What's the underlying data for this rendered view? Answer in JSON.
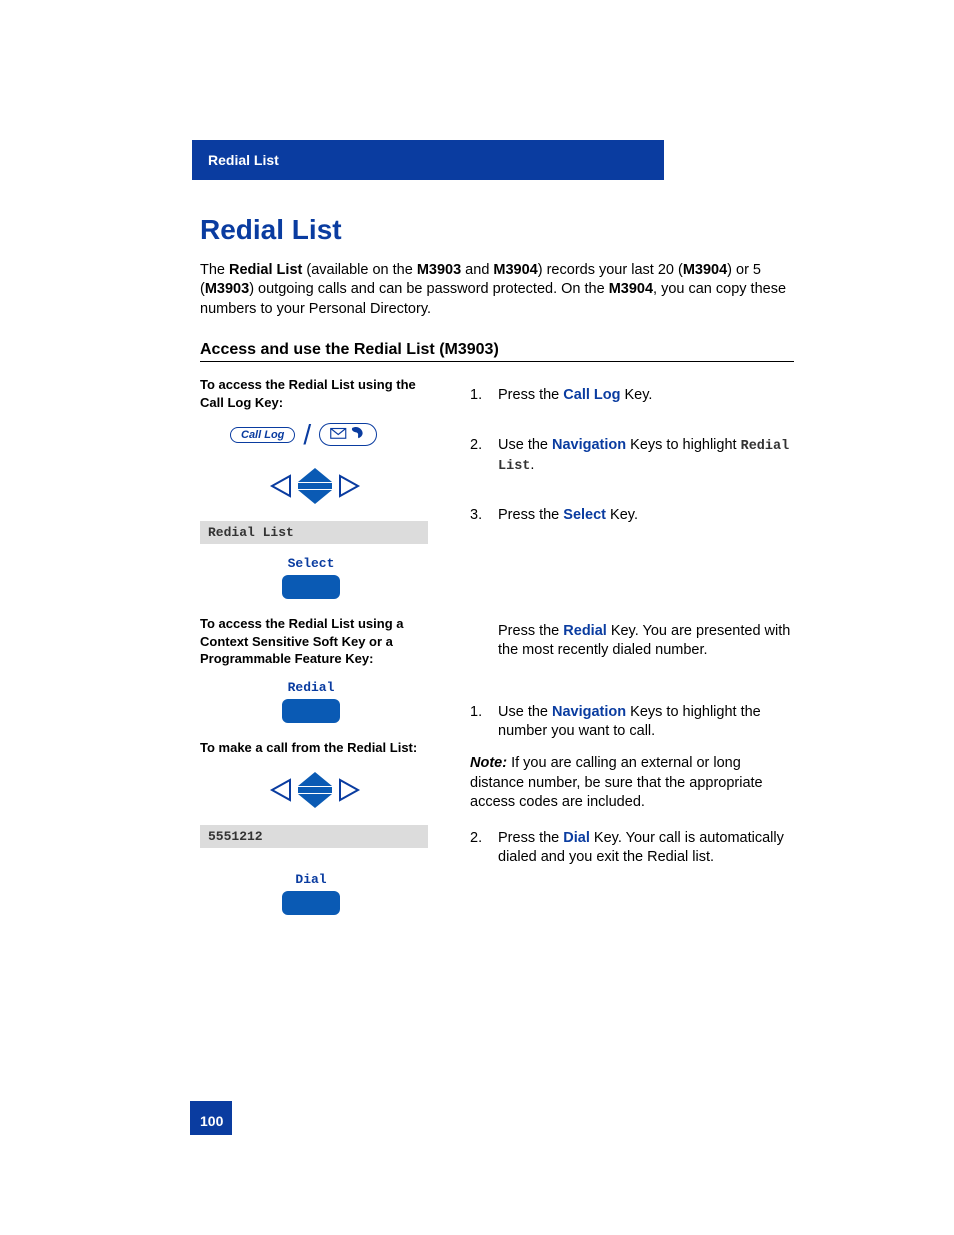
{
  "header": {
    "section": "Redial List"
  },
  "title": "Redial List",
  "intro": {
    "t1": "The ",
    "b1": "Redial List",
    "t2": " (available on the ",
    "b2": "M3903",
    "t3": " and ",
    "b3": "M3904",
    "t4": ") records your last 20 (",
    "b4": "M3904",
    "t5": ") or 5 (",
    "b5": "M3903",
    "t6": ") outgoing calls and can be password protected. On the ",
    "b6": "M3904",
    "t7": ", you can copy these numbers to your Personal Directory."
  },
  "subhead": "Access and use the Redial List (M3903)",
  "left": {
    "h1": "To access the Redial List using the Call Log Key:",
    "call_log_label": "Call Log",
    "lcd1": "Redial List",
    "sk_select": "Select",
    "h2": "To access the Redial List using a Context Sensitive Soft Key or a Programmable Feature Key:",
    "sk_redial": "Redial",
    "h3": "To make a call from the Redial List:",
    "lcd2": "5551212",
    "sk_dial": "Dial"
  },
  "steps": {
    "s1": {
      "num": "1.",
      "pre": "Press the ",
      "key": "Call Log",
      "post": " Key."
    },
    "s2": {
      "num": "2.",
      "pre": "Use the ",
      "key": "Navigation",
      "mid": " Keys to highlight ",
      "mono": "Redial List",
      "end": "."
    },
    "s3": {
      "num": "3.",
      "pre": "Press the ",
      "key": "Select",
      "post": " Key."
    },
    "redial": {
      "pre": "Press the ",
      "key": "Redial",
      "post": " Key. You are presented with the most recently dialed number."
    },
    "s4": {
      "num": "1.",
      "pre": "Use the ",
      "key": "Navigation",
      "post": " Keys to highlight the number you want to call."
    },
    "note": {
      "label": "Note:",
      "body": "  If you are calling an external or long distance number, be sure that the appropriate access codes are included."
    },
    "s5": {
      "num": "2.",
      "pre": "Press the ",
      "key": "Dial",
      "post": " Key. Your call is automatically dialed and you exit the Redial list."
    }
  },
  "page_number": "100"
}
